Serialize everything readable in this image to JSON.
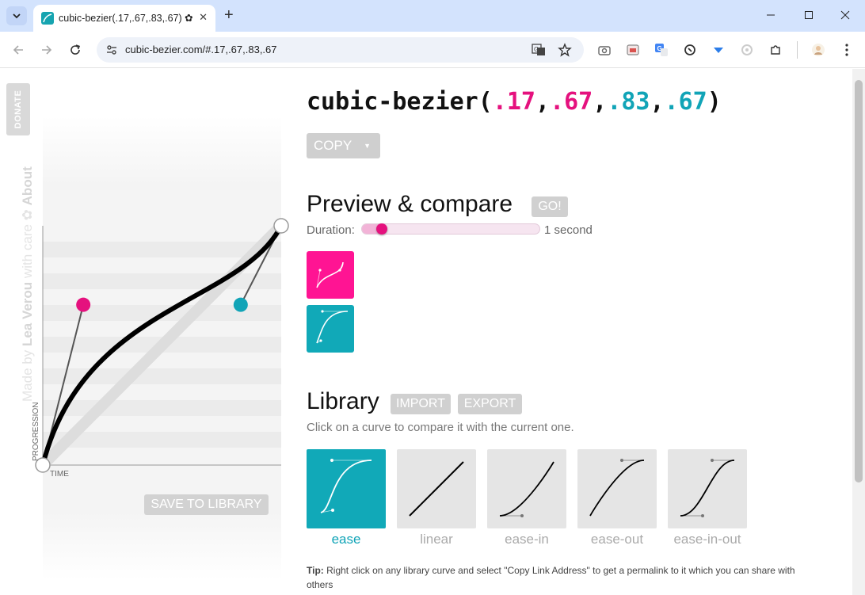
{
  "browser": {
    "tab_title": "cubic-bezier(.17,.67,.83,.67) ✿ ·",
    "url": "cubic-bezier.com/#.17,.67,.83,.67"
  },
  "sidebar": {
    "donate_label": "DONATE",
    "made_by_prefix": "Made by ",
    "made_by_author": "Lea Verou",
    "made_by_suffix": " with care ✿ ",
    "about_label": "About"
  },
  "graph": {
    "axis_progression": "PROGRESSION",
    "axis_time": "TIME",
    "save_label": "SAVE TO LIBRARY",
    "control_points": [
      0.17,
      0.67,
      0.83,
      0.67
    ],
    "p1_color": "#e5117e",
    "p2_color": "#11a4b7"
  },
  "header": {
    "func": "cubic-bezier(",
    "p1x": ".17",
    "comma1": ",",
    "p1y": ".67",
    "comma2": ",",
    "p2x": ".83",
    "comma3": ",",
    "p2y": ".67",
    "close": ")",
    "copy_label": "COPY"
  },
  "preview": {
    "heading": "Preview & compare",
    "go_label": "GO!",
    "duration_label": "Duration:",
    "duration_value": "1 second",
    "duration_fraction": 0.12,
    "current_color": "#ff1493",
    "compare_color": "#11a9b8"
  },
  "library": {
    "heading": "Library",
    "import_label": "IMPORT",
    "export_label": "EXPORT",
    "description": "Click on a curve to compare it with the current one.",
    "items": [
      {
        "label": "ease",
        "selected": true
      },
      {
        "label": "linear",
        "selected": false
      },
      {
        "label": "ease-in",
        "selected": false
      },
      {
        "label": "ease-out",
        "selected": false
      },
      {
        "label": "ease-in-out",
        "selected": false
      }
    ],
    "tip_label": "Tip:",
    "tip_text": " Right click on any library curve and select \"Copy Link Address\" to get a permalink to it which you can share with others"
  }
}
